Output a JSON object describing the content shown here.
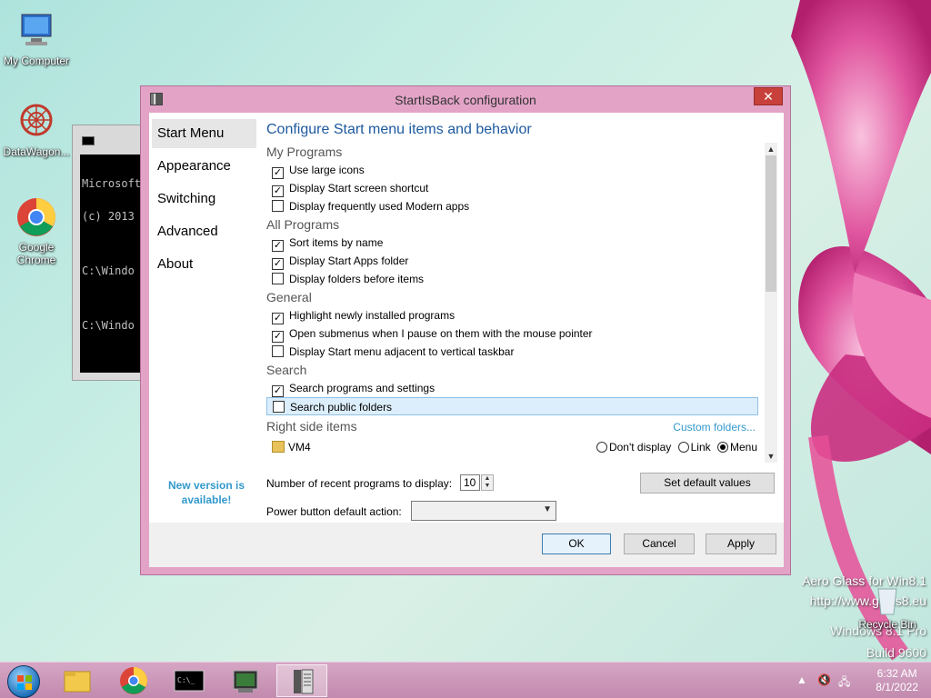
{
  "desktop": {
    "icons": [
      {
        "label": "My Computer"
      },
      {
        "label": "DataWagon..."
      },
      {
        "label": "Google Chrome"
      },
      {
        "label": "Recycle Bin"
      }
    ],
    "watermark_line1": "Aero Glass for Win8.1",
    "watermark_line2": "http://www.glass8.eu",
    "windows_line": "Windows 8.1 Pro",
    "build_line": "Build 9600"
  },
  "console": {
    "lines": [
      "Microsoft",
      "(c) 2013",
      "",
      "C:\\Windo",
      "",
      "C:\\Windo"
    ]
  },
  "dialog": {
    "title": "StartIsBack configuration",
    "close_glyph": "✕",
    "nav": [
      "Start Menu",
      "Appearance",
      "Switching",
      "Advanced",
      "About"
    ],
    "nav_active": "Start Menu",
    "new_version": "New version is available!",
    "heading": "Configure Start menu items and behavior",
    "groups": [
      {
        "title": "My Programs",
        "options": [
          {
            "label": "Use large icons",
            "checked": true
          },
          {
            "label": "Display Start screen shortcut",
            "checked": true
          },
          {
            "label": "Display frequently used Modern apps",
            "checked": false
          }
        ]
      },
      {
        "title": "All Programs",
        "options": [
          {
            "label": "Sort items by name",
            "checked": true
          },
          {
            "label": "Display Start Apps folder",
            "checked": true
          },
          {
            "label": "Display folders before items",
            "checked": false
          }
        ]
      },
      {
        "title": "General",
        "options": [
          {
            "label": "Highlight newly installed programs",
            "checked": true
          },
          {
            "label": "Open submenus when I pause on them with the mouse pointer",
            "checked": true
          },
          {
            "label": "Display Start menu adjacent to vertical taskbar",
            "checked": false
          }
        ]
      },
      {
        "title": "Search",
        "options": [
          {
            "label": "Search programs and settings",
            "checked": true
          },
          {
            "label": "Search public folders",
            "checked": false,
            "selected": true
          }
        ]
      }
    ],
    "right_side": {
      "title": "Right side items",
      "custom_link": "Custom folders...",
      "item": "VM4",
      "radio_options": [
        "Don't display",
        "Link",
        "Menu"
      ],
      "radio_selected": "Menu"
    },
    "recent_label": "Number of recent programs to display:",
    "recent_value": "10",
    "default_button": "Set default values",
    "power_label": "Power button default action:",
    "power_value": "",
    "ok": "OK",
    "cancel": "Cancel",
    "apply": "Apply"
  },
  "taskbar": {
    "time": "6:32 AM",
    "date": "8/1/2022"
  }
}
